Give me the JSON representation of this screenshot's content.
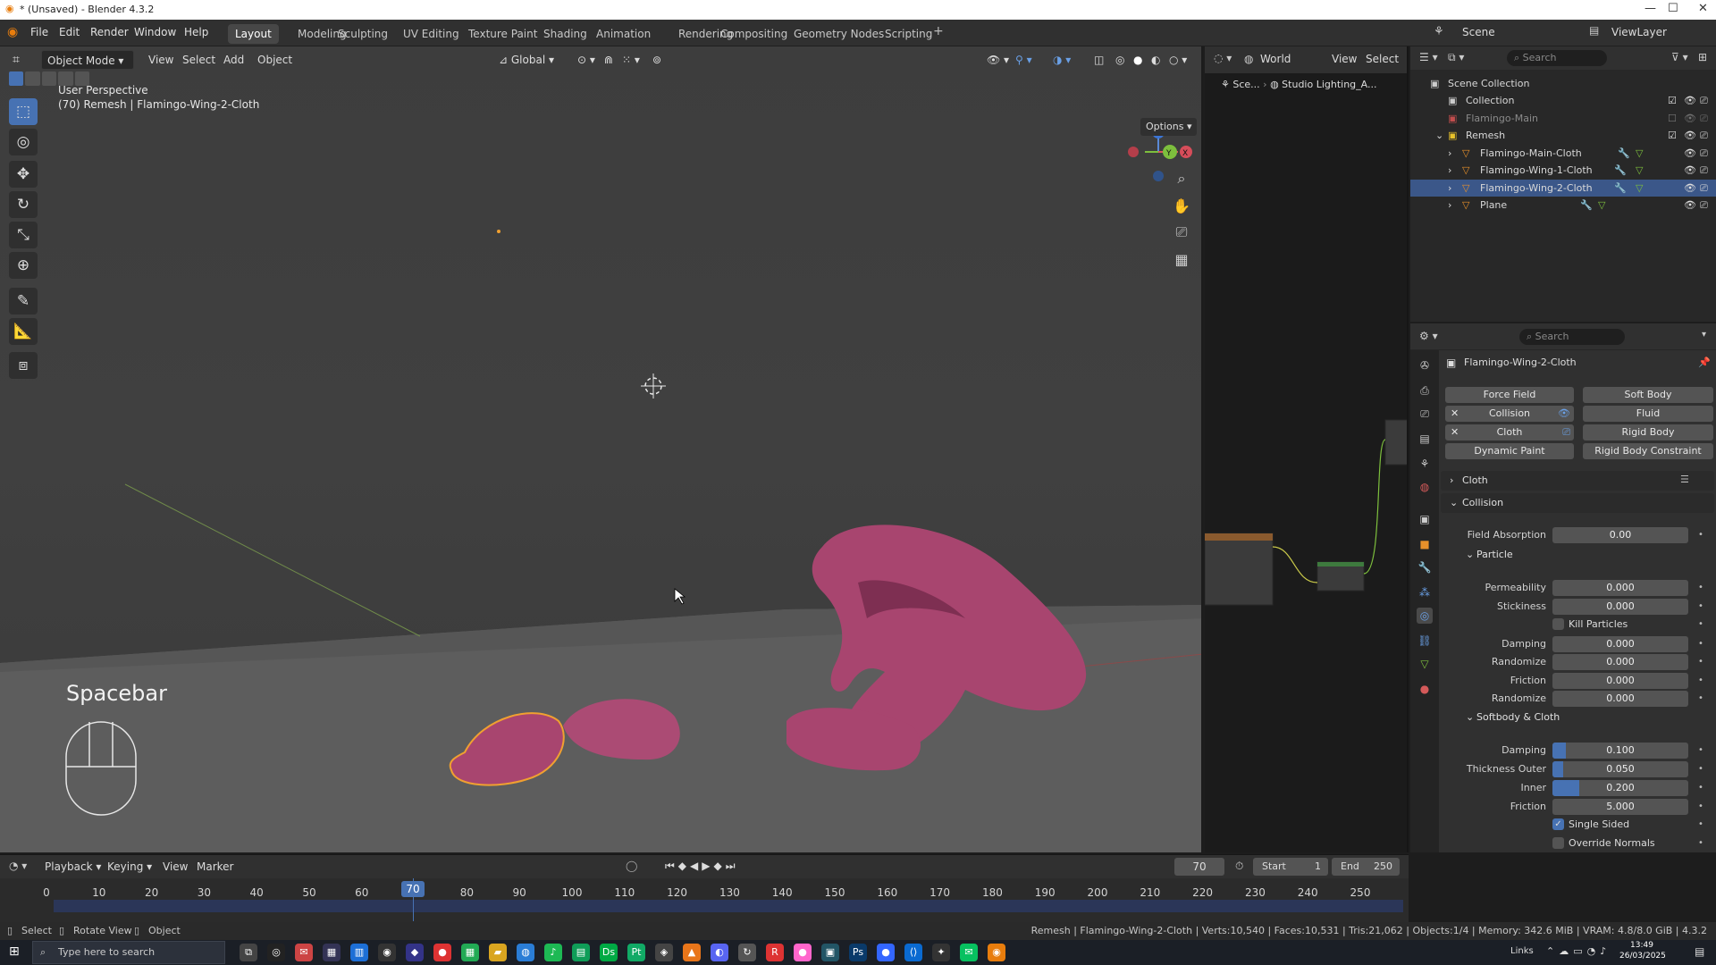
{
  "window": {
    "title": "* (Unsaved) - Blender 4.3.2"
  },
  "menu": {
    "file": "File",
    "edit": "Edit",
    "render": "Render",
    "window": "Window",
    "help": "Help"
  },
  "workspaces": [
    "Layout",
    "Modeling",
    "Sculpting",
    "UV Editing",
    "Texture Paint",
    "Shading",
    "Animation",
    "Rendering",
    "Compositing",
    "Geometry Nodes",
    "Scripting"
  ],
  "active_workspace": "Layout",
  "scene": {
    "label": "Scene",
    "view_layer": "ViewLayer"
  },
  "viewport_header": {
    "mode": "Object Mode",
    "view": "View",
    "select": "Select",
    "add": "Add",
    "object": "Object",
    "orientation": "Global",
    "options": "Options"
  },
  "viewport": {
    "perspective": "User Perspective",
    "object_info": "(70) Remesh | Flamingo-Wing-2-Cloth",
    "key_overlay": "Spacebar"
  },
  "node_header": {
    "world": "World",
    "view": "View",
    "select": "Select",
    "breadcrumb_scene": "Sce...",
    "breadcrumb_world": "Studio Lighting_A..."
  },
  "outliner": {
    "search_placeholder": "Search",
    "root": "Scene Collection",
    "rows": [
      {
        "label": "Collection",
        "indent": 1,
        "selected": false,
        "dim": false
      },
      {
        "label": "Flamingo-Main",
        "indent": 1,
        "selected": false,
        "dim": true
      },
      {
        "label": "Remesh",
        "indent": 1,
        "selected": false,
        "dim": false
      },
      {
        "label": "Flamingo-Main-Cloth",
        "indent": 2,
        "selected": false,
        "dim": false
      },
      {
        "label": "Flamingo-Wing-1-Cloth",
        "indent": 2,
        "selected": false,
        "dim": false
      },
      {
        "label": "Flamingo-Wing-2-Cloth",
        "indent": 2,
        "selected": true,
        "dim": false
      },
      {
        "label": "Plane",
        "indent": 2,
        "selected": false,
        "dim": false
      }
    ]
  },
  "properties": {
    "search_placeholder": "Search",
    "object_name": "Flamingo-Wing-2-Cloth",
    "physics_buttons": {
      "force_field": "Force Field",
      "soft_body": "Soft Body",
      "collision": "Collision",
      "fluid": "Fluid",
      "cloth": "Cloth",
      "rigid_body": "Rigid Body",
      "dynamic_paint": "Dynamic Paint",
      "rigid_body_constraint": "Rigid Body Constraint"
    },
    "panels": {
      "cloth": "Cloth",
      "collision": "Collision",
      "particle": "Particle",
      "softbody_cloth": "Softbody & Cloth"
    },
    "fields": {
      "field_absorption": {
        "label": "Field Absorption",
        "value": "0.00",
        "fill": 0
      },
      "permeability": {
        "label": "Permeability",
        "value": "0.000",
        "fill": 0
      },
      "stickiness": {
        "label": "Stickiness",
        "value": "0.000",
        "fill": 0
      },
      "kill_particles": {
        "label": "Kill Particles",
        "checked": false
      },
      "damping_p": {
        "label": "Damping",
        "value": "0.000",
        "fill": 0
      },
      "randomize_1": {
        "label": "Randomize",
        "value": "0.000",
        "fill": 0
      },
      "friction_p": {
        "label": "Friction",
        "value": "0.000",
        "fill": 0
      },
      "randomize_2": {
        "label": "Randomize",
        "value": "0.000",
        "fill": 0
      },
      "damping_s": {
        "label": "Damping",
        "value": "0.100",
        "fill": 0.1
      },
      "thickness_outer": {
        "label": "Thickness Outer",
        "value": "0.050",
        "fill": 0.05
      },
      "inner": {
        "label": "Inner",
        "value": "0.200",
        "fill": 0.2
      },
      "friction_s": {
        "label": "Friction",
        "value": "5.000",
        "fill": 0
      },
      "single_sided": {
        "label": "Single Sided",
        "checked": true
      },
      "override_normals": {
        "label": "Override Normals",
        "checked": false
      }
    }
  },
  "timeline": {
    "playback": "Playback",
    "keying": "Keying",
    "view": "View",
    "marker": "Marker",
    "current_frame": "70",
    "start_label": "Start",
    "start": "1",
    "end_label": "End",
    "end": "250",
    "ticks": [
      "0",
      "10",
      "20",
      "30",
      "40",
      "50",
      "60",
      "70",
      "80",
      "90",
      "100",
      "110",
      "120",
      "130",
      "140",
      "150",
      "160",
      "170",
      "180",
      "190",
      "200",
      "210",
      "220",
      "230",
      "240",
      "250"
    ]
  },
  "statusbar": {
    "select": "Select",
    "rotate": "Rotate View",
    "object": "Object",
    "info": "Remesh | Flamingo-Wing-2-Cloth | Verts:10,540 | Faces:10,531 | Tris:21,062 | Objects:1/4 | Memory: 342.6 MiB | VRAM: 4.8/8.0 GiB | 4.3.2"
  },
  "taskbar": {
    "search_placeholder": "Type here to search",
    "time": "13:49",
    "date": "26/03/2025",
    "links": "Links"
  },
  "colors": {
    "accent": "#4772b3",
    "selection_orange": "#f0a030",
    "flamingo": "#b04c78",
    "outliner_selected": "#3b5789"
  }
}
